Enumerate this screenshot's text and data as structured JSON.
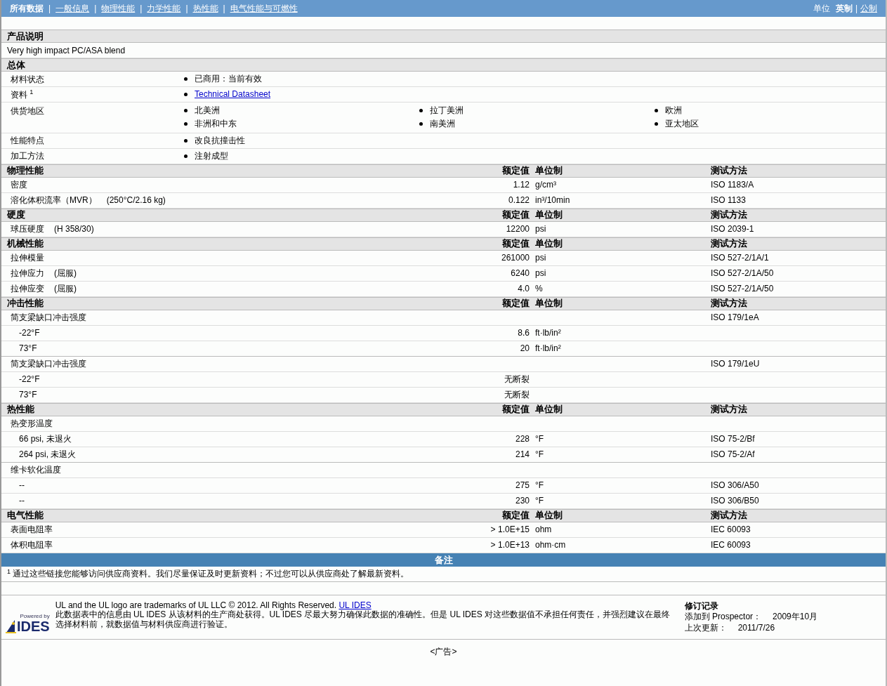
{
  "nav": {
    "tabs": [
      {
        "label": "所有数据",
        "selected": true
      },
      {
        "label": "一般信息",
        "selected": false
      },
      {
        "label": "物理性能",
        "selected": false
      },
      {
        "label": "力学性能",
        "selected": false
      },
      {
        "label": "热性能",
        "selected": false
      },
      {
        "label": "电气性能与可燃性",
        "selected": false
      }
    ],
    "separator": "|",
    "units_label": "单位",
    "units": [
      {
        "label": "英制",
        "selected": true
      },
      {
        "label": "公制",
        "selected": false
      }
    ]
  },
  "description": {
    "title": "产品说明",
    "text": "Very high impact PC/ASA blend"
  },
  "general": {
    "title": "总体",
    "rows": [
      {
        "label": "材料状态",
        "items": [
          {
            "kind": "text",
            "text": "已商用：当前有效"
          }
        ]
      },
      {
        "label": "资料 $^{1}$",
        "items": [
          {
            "kind": "link",
            "text": "Technical Datasheet"
          }
        ]
      },
      {
        "label": "供货地区",
        "items": [
          {
            "kind": "text",
            "text": "北美洲"
          },
          {
            "kind": "text",
            "text": "拉丁美洲"
          },
          {
            "kind": "text",
            "text": "欧洲"
          },
          {
            "kind": "text",
            "text": "非洲和中东"
          },
          {
            "kind": "text",
            "text": "南美洲"
          },
          {
            "kind": "text",
            "text": "亚太地区"
          }
        ]
      },
      {
        "label": "性能特点",
        "items": [
          {
            "kind": "text",
            "text": "改良抗撞击性"
          }
        ]
      },
      {
        "label": "加工方法",
        "items": [
          {
            "kind": "text",
            "text": "注射成型"
          }
        ]
      }
    ]
  },
  "sections": [
    {
      "title": "物理性能",
      "headers": {
        "value": "额定值",
        "unit": "单位制",
        "method": "测试方法"
      },
      "rows": [
        {
          "label": "密度",
          "value": "1.12",
          "unit": "g/cm³",
          "method": "ISO 1183/A"
        },
        {
          "label": "溶化体积流率（MVR）",
          "condition": "(250°C/2.16 kg)",
          "value": "0.122",
          "unit": "in³/10min",
          "method": "ISO 1133"
        }
      ]
    },
    {
      "title": "硬度",
      "headers": {
        "value": "额定值",
        "unit": "单位制",
        "method": "测试方法"
      },
      "rows": [
        {
          "label": "球压硬度",
          "condition": "(H 358/30)",
          "value": "12200",
          "unit": "psi",
          "method": "ISO 2039-1"
        }
      ]
    },
    {
      "title": "机械性能",
      "headers": {
        "value": "额定值",
        "unit": "单位制",
        "method": "测试方法"
      },
      "rows": [
        {
          "label": "拉伸模量",
          "value": "261000",
          "unit": "psi",
          "method": "ISO 527-2/1A/1"
        },
        {
          "label": "拉伸应力",
          "condition": "(屈服)",
          "value": "6240",
          "unit": "psi",
          "method": "ISO 527-2/1A/50"
        },
        {
          "label": "拉伸应变",
          "condition": "(屈服)",
          "value": "4.0",
          "unit": "%",
          "method": "ISO 527-2/1A/50"
        }
      ]
    },
    {
      "title": "冲击性能",
      "headers": {
        "value": "额定值",
        "unit": "单位制",
        "method": "测试方法"
      },
      "rows": [
        {
          "label": "简支梁缺口冲击强度",
          "method": "ISO 179/1eA",
          "children": [
            {
              "label": "-22°F",
              "value": "8.6",
              "unit": "ft·lb/in²"
            },
            {
              "label": "73°F",
              "value": "20",
              "unit": "ft·lb/in²"
            }
          ]
        },
        {
          "label": "简支梁缺口冲击强度",
          "method": "ISO 179/1eU",
          "children": [
            {
              "label": "-22°F",
              "value": "无断裂"
            },
            {
              "label": "73°F",
              "value": "无断裂"
            }
          ]
        }
      ]
    },
    {
      "title": "热性能",
      "headers": {
        "value": "额定值",
        "unit": "单位制",
        "method": "测试方法"
      },
      "rows": [
        {
          "label": "热变形温度",
          "children": [
            {
              "label": "66 psi, 未退火",
              "value": "228",
              "unit": "°F",
              "method": "ISO 75-2/Bf"
            },
            {
              "label": "264 psi, 未退火",
              "value": "214",
              "unit": "°F",
              "method": "ISO 75-2/Af"
            }
          ]
        },
        {
          "label": "维卡软化温度",
          "children": [
            {
              "label": "--",
              "value": "275",
              "unit": "°F",
              "method": "ISO 306/A50"
            },
            {
              "label": "--",
              "value": "230",
              "unit": "°F",
              "method": "ISO 306/B50"
            }
          ]
        }
      ]
    },
    {
      "title": "电气性能",
      "headers": {
        "value": "额定值",
        "unit": "单位制",
        "method": "测试方法"
      },
      "rows": [
        {
          "label": "表面电阻率",
          "value": "> 1.0E+15",
          "unit": "ohm",
          "method": "IEC 60093"
        },
        {
          "label": "体积电阻率",
          "value": "> 1.0E+13",
          "unit": "ohm·cm",
          "method": "IEC 60093"
        }
      ]
    }
  ],
  "notes": {
    "title": "备注",
    "footnote": "$^{1}$ 通过这些链接您能够访问供应商资料。我们尽量保证及时更新资料；不过您可以从供应商处了解最新资料。"
  },
  "footer": {
    "logo": {
      "caption": "Powered by",
      "wordmark": "IDES"
    },
    "trademark": "UL and the UL logo are trademarks of UL LLC © 2012. All Rights Reserved.",
    "trademark_link": "UL IDES",
    "disclaimer": "此数据表中的信息由 UL IDES 从该材料的生产商处获得。UL IDES 尽最大努力确保此数据的准确性。但是 UL IDES 对这些数据值不承担任何责任，并强烈建议在最终选择材料前，就数据值与材料供应商进行验证。",
    "revision": {
      "title": "修订记录",
      "rows": [
        {
          "label": "添加到 Prospector：",
          "value": "2009年10月"
        },
        {
          "label": "上次更新：",
          "value": "2011/7/26"
        }
      ]
    }
  },
  "ad": "<广告>"
}
